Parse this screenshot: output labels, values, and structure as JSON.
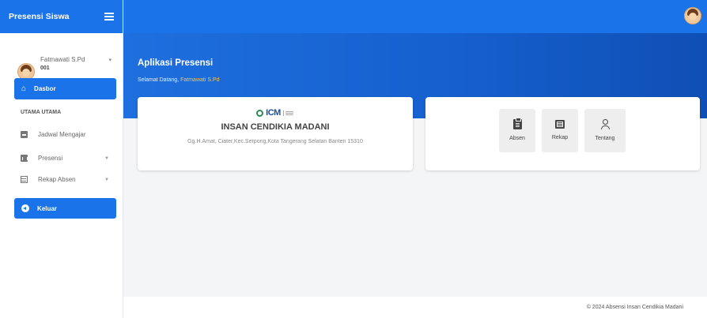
{
  "app": {
    "title": "Presensi Siswa"
  },
  "user": {
    "name": "Fatmawati S.Pd",
    "id": "001"
  },
  "sidebar": {
    "active_item": {
      "label": "Dasbor",
      "icon": "home-icon"
    },
    "section_label": "UTAMA UTAMA",
    "items": [
      {
        "label": "Jadwal Mengajar",
        "icon": "clipboard-icon"
      },
      {
        "label": "Presensi",
        "icon": "trash-icon"
      },
      {
        "label": "Rekap Absen",
        "icon": "table-icon"
      }
    ],
    "logout": {
      "label": "Keluar",
      "icon": "sign-out-icon"
    }
  },
  "header": {
    "title": "Aplikasi Presensi",
    "welcome_prefix": "Selamat Datang,",
    "welcome_name": "Fatmawati S.Pd"
  },
  "school": {
    "logo_text": "ICM",
    "name": "INSAN CENDIKIA MADANI",
    "address": "Gg.H.Amat, Ciater,Kec.Serpong,Kota Tangerang Selatan Banten 15310"
  },
  "menu_tiles": [
    {
      "label": "Absen",
      "icon": "clipboard-list-icon"
    },
    {
      "label": "Rekap",
      "icon": "list-icon"
    },
    {
      "label": "Tentang",
      "icon": "user-icon"
    }
  ],
  "footer": {
    "text": "© 2024 Absensi Insan Cendikia Madani"
  },
  "colors": {
    "primary": "#1a73e8",
    "accent_name": "#f6c44a"
  }
}
